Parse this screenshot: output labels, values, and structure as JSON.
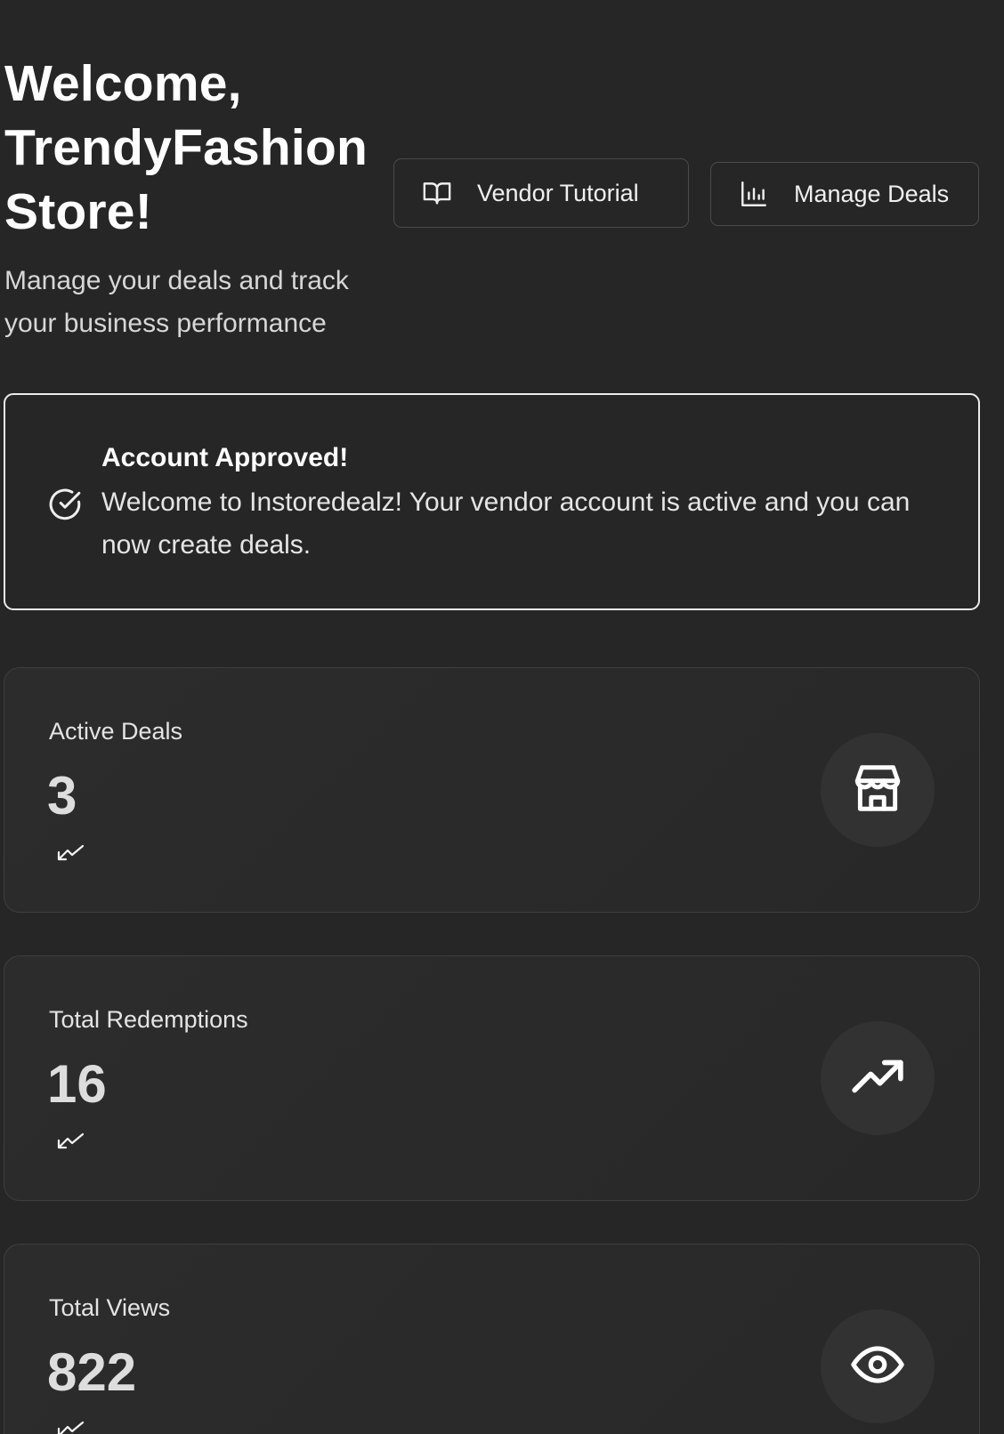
{
  "header": {
    "title": "Welcome, TrendyFashion Store!",
    "subtitle": "Manage your deals and track your business performance",
    "buttons": [
      {
        "label": "Vendor Tutorial",
        "icon": "book-open-icon"
      },
      {
        "label": "Manage Deals",
        "icon": "bar-chart-icon"
      }
    ]
  },
  "alert": {
    "title": "Account Approved!",
    "message": "Welcome to Instoredealz! Your vendor account is active and you can now create deals.",
    "icon": "check-circle-icon",
    "border_color": "#ececec"
  },
  "stats": [
    {
      "label": "Active Deals",
      "value": "3",
      "icon": "store-icon",
      "trend_icon": "trend-icon"
    },
    {
      "label": "Total Redemptions",
      "value": "16",
      "icon": "trending-up-icon",
      "trend_icon": "trend-icon"
    },
    {
      "label": "Total Views",
      "value": "822",
      "icon": "eye-icon",
      "trend_icon": "trend-icon"
    }
  ],
  "colors": {
    "background": "#262626",
    "card_background": "#2b2b2b",
    "card_border": "#3e3e3e",
    "text_primary": "#ffffff",
    "text_secondary": "#d7d7d7"
  }
}
